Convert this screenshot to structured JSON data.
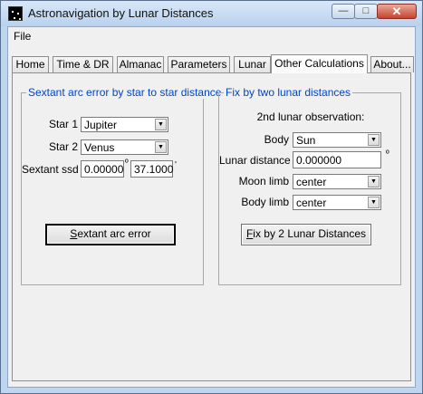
{
  "window": {
    "title": "Astronavigation by Lunar Distances"
  },
  "menu": {
    "file": "File"
  },
  "tabs": [
    {
      "label": "Home"
    },
    {
      "label": "Time  & DR"
    },
    {
      "label": "Almanac"
    },
    {
      "label": "Parameters"
    },
    {
      "label": "Lunar"
    },
    {
      "label": "Other Calculations"
    },
    {
      "label": "About..."
    }
  ],
  "left_group": {
    "title": "Sextant arc error by star to star distance",
    "star1": {
      "label": "Star 1",
      "value": "Jupiter"
    },
    "star2": {
      "label": "Star 2",
      "value": "Venus"
    },
    "ssd": {
      "label": "Sextant ssd",
      "deg_value": "0.00000",
      "deg_symbol": "º",
      "min_value": "37.1000",
      "min_symbol": "'"
    },
    "button_rest": "extant arc error",
    "button_underline": "S"
  },
  "right_group": {
    "title": "Fix by two lunar distances",
    "subtitle": "2nd lunar observation:",
    "body": {
      "label": "Body",
      "value": "Sun"
    },
    "lunar_distance": {
      "label": "Lunar distance",
      "value": "0.000000",
      "symbol": "º"
    },
    "moon_limb": {
      "label": "Moon limb",
      "value": "center"
    },
    "body_limb": {
      "label": "Body limb",
      "value": "center"
    },
    "button_underline": "F",
    "button_rest": "ix by 2 Lunar Distances"
  }
}
